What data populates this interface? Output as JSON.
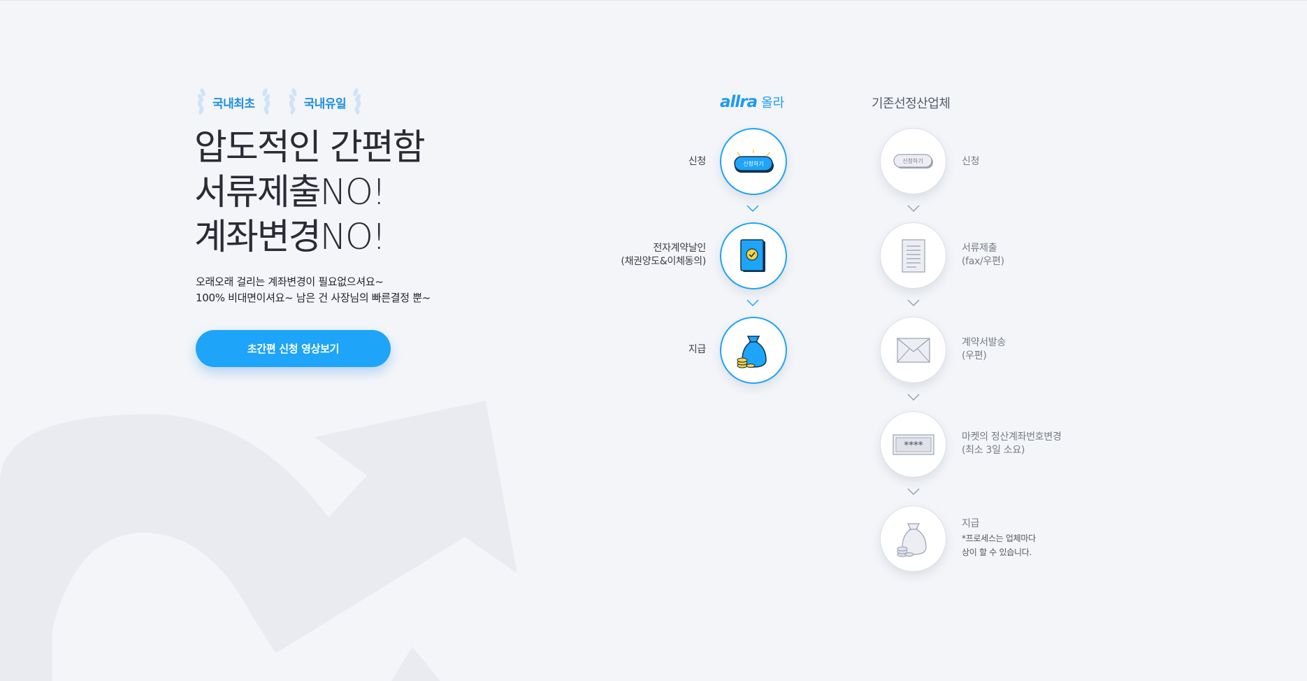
{
  "badges": [
    "국내최초",
    "국내유일"
  ],
  "headline": [
    "압도적인 간편함",
    "서류제출NO!",
    "계좌변경NO!"
  ],
  "subtext": [
    "오래오래 걸리는 계좌변경이 필요없으셔요~",
    "100% 비대면이셔요~ 남은 건 사장님의 빠른결정 뿐~"
  ],
  "cta_label": "초간편 신청 영상보기",
  "allra": {
    "logo_text": "allra",
    "logo_kr": "올라",
    "steps": [
      {
        "label": [
          "신청"
        ],
        "icon": "apply-button-icon",
        "icon_text": "신청하기"
      },
      {
        "label": [
          "전자계약날인",
          "(채권양도&이체동의)"
        ],
        "icon": "contract-sign-icon"
      },
      {
        "label": [
          "지급"
        ],
        "icon": "money-bag-icon"
      }
    ]
  },
  "existing": {
    "title": "기존선정산업체",
    "steps": [
      {
        "label": [
          "신청"
        ],
        "icon": "apply-button-icon",
        "icon_text": "신청하기"
      },
      {
        "label": [
          "서류제출",
          "(fax/우편)"
        ],
        "icon": "document-icon"
      },
      {
        "label": [
          "계약서발송",
          "(우편)"
        ],
        "icon": "envelope-icon"
      },
      {
        "label": [
          "마켓의 정산계좌번호변경",
          "(최소 3일 소요)"
        ],
        "icon": "password-card-icon",
        "icon_text": "****"
      },
      {
        "label": [
          "지급"
        ],
        "note": [
          "*프로세스는 업체마다",
          "상이 할 수 있습니다."
        ],
        "icon": "money-bag-icon"
      }
    ]
  },
  "colors": {
    "accent": "#1ea4f8",
    "background": "#f3f5f9",
    "brand": "#1e9af0"
  }
}
